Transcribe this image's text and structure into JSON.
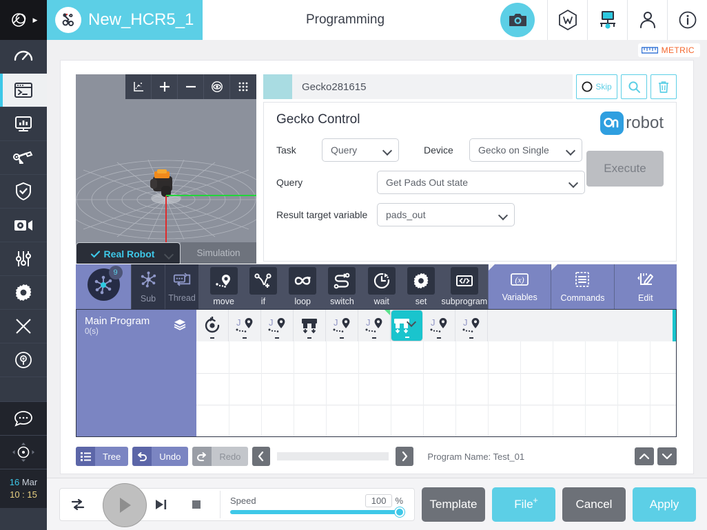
{
  "sidebar": {
    "logo_name": "app-logo",
    "items": [
      {
        "name": "dashboard",
        "icon": "gauge-icon"
      },
      {
        "name": "programming",
        "icon": "terminal-icon",
        "active": true
      },
      {
        "name": "monitor",
        "icon": "monitor-chart-icon"
      },
      {
        "name": "robot-arm",
        "icon": "robot-arm-icon"
      },
      {
        "name": "safety",
        "icon": "shield-check-icon"
      },
      {
        "name": "vision",
        "icon": "camera-gear-icon"
      },
      {
        "name": "tuning",
        "icon": "sliders-icon"
      },
      {
        "name": "settings",
        "icon": "gear-icon"
      },
      {
        "name": "extensions",
        "icon": "x-icon"
      },
      {
        "name": "power",
        "icon": "power-dial-icon"
      }
    ],
    "chat_icon": "chat-bubble-icon",
    "jog_icon": "jog-move-icon",
    "clock": {
      "day": "16",
      "month": "Mar",
      "time": "10 : 15"
    }
  },
  "topbar": {
    "tab_label": "New_HCR5_1",
    "tab_icon": "robot-tab-icon",
    "center_title": "Programming",
    "camera_icon": "camera-icon",
    "buttons": [
      {
        "name": "w-hex-button",
        "icon": "w-hexagon-icon"
      },
      {
        "name": "remote-display-button",
        "icon": "display-network-icon"
      },
      {
        "name": "user-button",
        "icon": "person-icon"
      },
      {
        "name": "info-button",
        "icon": "info-circle-icon"
      }
    ]
  },
  "metric": {
    "label": "METRIC",
    "icon": "ruler-icon"
  },
  "viewport": {
    "toolbar": [
      {
        "name": "axis-view-button",
        "icon": "axis-icon"
      },
      {
        "name": "zoom-in-button",
        "icon": "plus-icon"
      },
      {
        "name": "zoom-out-button",
        "icon": "minus-icon"
      },
      {
        "name": "eye-view-button",
        "icon": "eye-icon"
      },
      {
        "name": "grid-view-button",
        "icon": "grid-dots-icon"
      }
    ],
    "tab_real": "Real Robot",
    "tab_sim": "Simulation",
    "check_icon": "check-icon"
  },
  "node_header": {
    "name": "Gecko281615",
    "skip_label": "Skip",
    "skip_icon": "circle-icon",
    "search_icon": "magnifier-icon",
    "delete_icon": "trash-icon"
  },
  "gecko": {
    "title": "Gecko Control",
    "brand": "robot",
    "brand_mark": "onrobot-logo-icon",
    "task_label": "Task",
    "task_value": "Query",
    "device_label": "Device",
    "device_value": "Gecko on Single",
    "query_label": "Query",
    "query_value": "Get Pads Out state",
    "result_label": "Result target variable",
    "result_value": "pads_out",
    "execute_label": "Execute"
  },
  "palette": {
    "main_badge": "9",
    "main_icon": "main-program-node-icon",
    "sub_label": "Sub",
    "sub_icon": "sub-program-node-icon",
    "thread_label": "Thread",
    "thread_icon": "thread-node-icon",
    "tools": [
      {
        "label": "move",
        "icon": "move-waypoint-icon"
      },
      {
        "label": "if",
        "icon": "if-branch-icon"
      },
      {
        "label": "loop",
        "icon": "loop-infinity-icon"
      },
      {
        "label": "switch",
        "icon": "switch-case-icon"
      },
      {
        "label": "wait",
        "icon": "wait-clock-icon"
      },
      {
        "label": "set",
        "icon": "set-gear-icon"
      },
      {
        "label": "subprogram",
        "icon": "code-brackets-icon"
      }
    ],
    "right_items": [
      {
        "label": "Variables",
        "icon": "variables-x-icon"
      },
      {
        "label": "Commands",
        "icon": "commands-list-icon"
      },
      {
        "label": "Edit",
        "icon": "edit-pencil-icon"
      }
    ]
  },
  "tree": {
    "main_label": "Main Program",
    "main_time": "0(s)",
    "layers_icon": "layers-icon",
    "nodes": [
      {
        "icon": "loop-start-icon",
        "selected": false,
        "flag": false
      },
      {
        "icon": "move-joint-icon",
        "selected": false,
        "flag": false
      },
      {
        "icon": "move-joint-icon",
        "selected": false,
        "flag": false
      },
      {
        "icon": "gripper-icon",
        "selected": false,
        "flag": false
      },
      {
        "icon": "move-joint-icon",
        "selected": false,
        "flag": false
      },
      {
        "icon": "move-joint-icon",
        "selected": false,
        "flag": true
      },
      {
        "icon": "gripper-icon",
        "selected": true,
        "flag": false
      },
      {
        "icon": "move-joint-icon",
        "selected": false,
        "flag": false
      },
      {
        "icon": "move-joint-icon",
        "selected": false,
        "flag": false
      }
    ]
  },
  "lowbar": {
    "tree_label": "Tree",
    "tree_icon": "list-icon",
    "undo_label": "Undo",
    "undo_icon": "undo-arrow-icon",
    "redo_label": "Redo",
    "redo_icon": "redo-arrow-icon",
    "prev_icon": "chevron-left-icon",
    "next_icon": "chevron-right-icon",
    "program_name": "Program Name: Test_01",
    "up_icon": "chevron-up-icon",
    "down_icon": "chevron-down-icon"
  },
  "bottombar": {
    "loop_icon": "repeat-icon",
    "play_icon": "play-icon",
    "step_icon": "step-forward-icon",
    "stop_icon": "stop-icon",
    "speed_label": "Speed",
    "speed_value": "100",
    "speed_unit": "%",
    "speed_percent": 100,
    "actions": [
      {
        "label": "Template",
        "style": "grey"
      },
      {
        "label": "File",
        "style": "cyan",
        "superscript": "+"
      },
      {
        "label": "Cancel",
        "style": "grey"
      },
      {
        "label": "Apply",
        "style": "cyan"
      }
    ]
  },
  "colors": {
    "accent_cyan": "#5ccfe6",
    "sidebar_dark": "#343a46",
    "palette_purple": "#7b85c2",
    "selected_node": "#1ac4cd",
    "metric_orange": "#f4652b"
  }
}
